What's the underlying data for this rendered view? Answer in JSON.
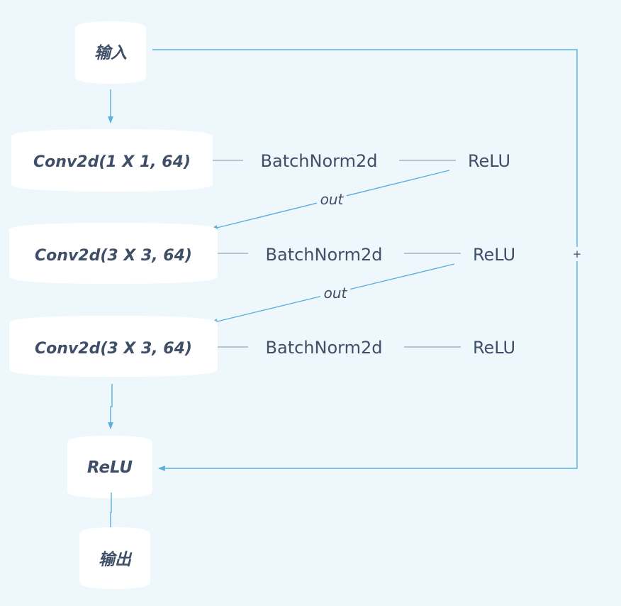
{
  "nodes": {
    "input": "输入",
    "conv1": "Conv2d(1 X 1, 64)",
    "conv2": "Conv2d(3 X 3, 64)",
    "conv3": "Conv2d(3 X 3, 64)",
    "relu_final": "ReLU",
    "output": "输出"
  },
  "rows": [
    {
      "batchnorm": "BatchNorm2d",
      "relu": "ReLU"
    },
    {
      "batchnorm": "BatchNorm2d",
      "relu": "ReLU"
    },
    {
      "batchnorm": "BatchNorm2d",
      "relu": "ReLU"
    }
  ],
  "edges": {
    "out_1": "out",
    "out_2": "out",
    "skip_plus": "+"
  },
  "colors": {
    "background": "#eef7fb",
    "connector": "#5ab0dc",
    "text": "#3f4f68"
  }
}
